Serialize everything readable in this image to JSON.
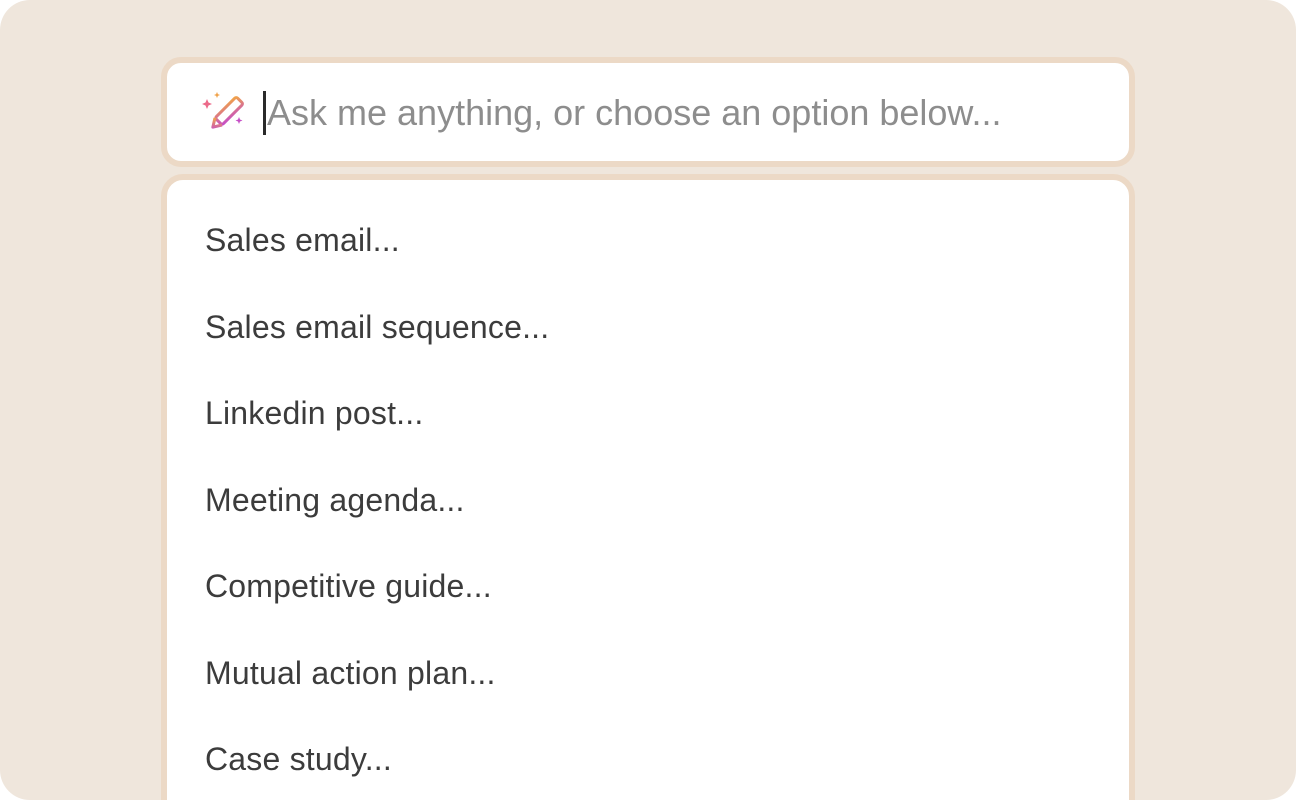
{
  "search": {
    "placeholder": "Ask me anything, or choose an option below...",
    "value": ""
  },
  "icons": {
    "ai": "sparkle-pencil-icon"
  },
  "colors": {
    "background": "#efe6dc",
    "border": "#ecd9c6",
    "icon_gradient_start": "#f0a24a",
    "icon_gradient_end": "#c64fc6"
  },
  "menu": {
    "items": [
      {
        "label": "Sales email..."
      },
      {
        "label": "Sales email sequence..."
      },
      {
        "label": "Linkedin post..."
      },
      {
        "label": "Meeting agenda..."
      },
      {
        "label": "Competitive guide..."
      },
      {
        "label": "Mutual action plan..."
      },
      {
        "label": "Case study..."
      }
    ]
  }
}
